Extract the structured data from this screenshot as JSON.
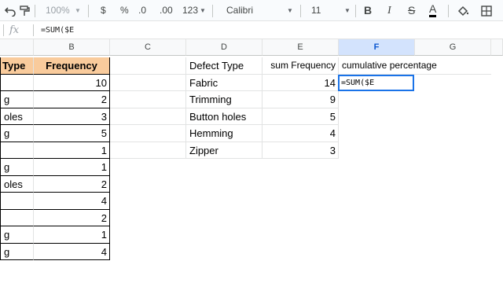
{
  "toolbar": {
    "zoom": "100%",
    "currency": "$",
    "percent": "%",
    "decrease_decimals": ".0",
    "increase_decimals": ".00",
    "number_format": "123",
    "font_family": "Calibri",
    "font_size": "11",
    "bold": "B",
    "italic": "I",
    "strikethrough": "S",
    "text_color": "A"
  },
  "formula_bar": {
    "fx": "fx",
    "content": "=SUM($E"
  },
  "columns": [
    "B",
    "C",
    "D",
    "E",
    "F",
    "G"
  ],
  "table_left": {
    "header_a": "Type",
    "header_b": "Frequency",
    "rows": [
      {
        "a": "",
        "b": "10"
      },
      {
        "a": "g",
        "b": "2"
      },
      {
        "a": "oles",
        "b": "3"
      },
      {
        "a": "g",
        "b": "5"
      },
      {
        "a": "",
        "b": "1"
      },
      {
        "a": "g",
        "b": "1"
      },
      {
        "a": "oles",
        "b": "2"
      },
      {
        "a": "",
        "b": "4"
      },
      {
        "a": "",
        "b": "2"
      },
      {
        "a": "g",
        "b": "1"
      },
      {
        "a": "g",
        "b": "4"
      }
    ]
  },
  "summary": {
    "header_d": "Defect Type",
    "header_e": "sum Frequency",
    "header_f": "cumulative percentage",
    "rows": [
      {
        "d": "Fabric",
        "e": "14",
        "f": "=SUM($E"
      },
      {
        "d": "Trimming",
        "e": "9",
        "f": ""
      },
      {
        "d": "Button holes",
        "e": "5",
        "f": ""
      },
      {
        "d": "Hemming",
        "e": "4",
        "f": ""
      },
      {
        "d": "Zipper",
        "e": "3",
        "f": ""
      }
    ]
  },
  "colors": {
    "header_fill": "#f9cb9c",
    "selection": "#1a73e8"
  }
}
